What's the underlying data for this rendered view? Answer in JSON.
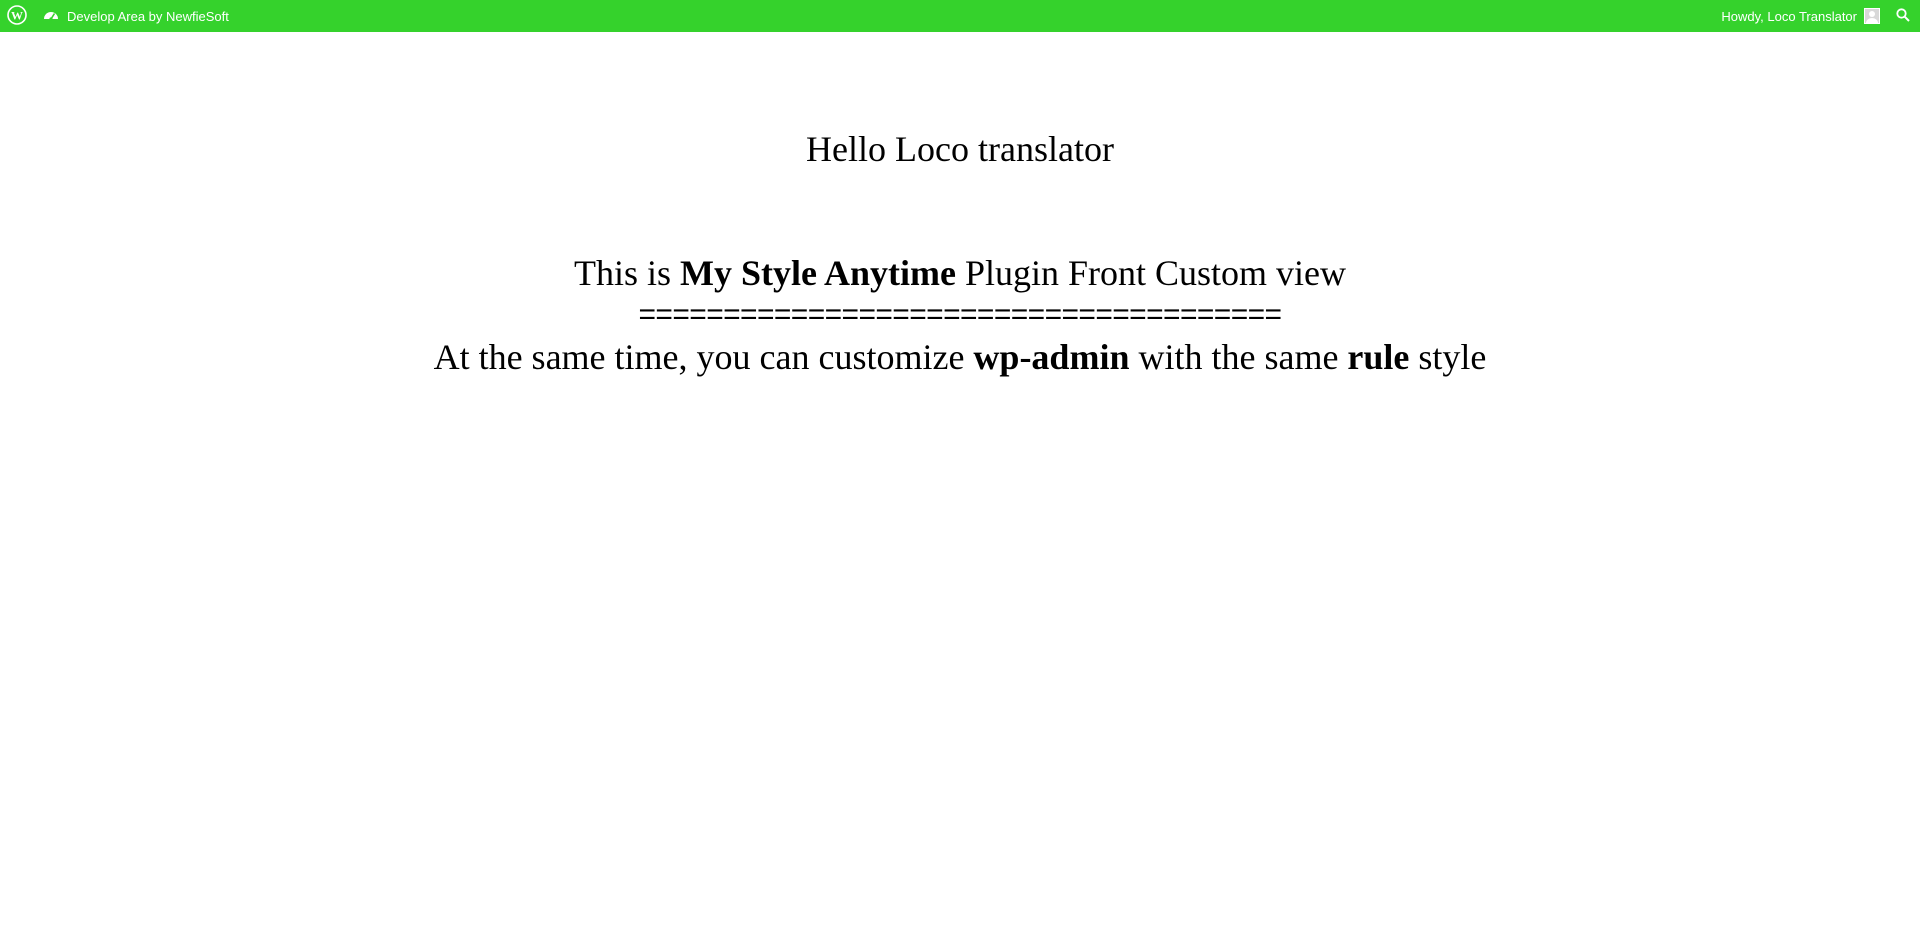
{
  "adminbar": {
    "background": "#35d22c",
    "logo_icon": "wordpress-logo-icon",
    "site_icon": "dashboard-icon",
    "site_name": "Develop Area by NewfieSoft",
    "howdy": "Howdy, Loco Translator",
    "avatar_icon": "user-avatar-icon",
    "search_icon": "search-icon"
  },
  "content": {
    "greeting": "Hello Loco translator",
    "line1": {
      "prefix": "This is ",
      "bold": "My Style Anytime",
      "suffix": " Plugin Front Custom view"
    },
    "divider": "======================================",
    "line2": {
      "part1": "At the same time, you can customize ",
      "bold1": "wp-admin",
      "part2": " with the same ",
      "bold2": "rule",
      "part3": " style"
    }
  }
}
